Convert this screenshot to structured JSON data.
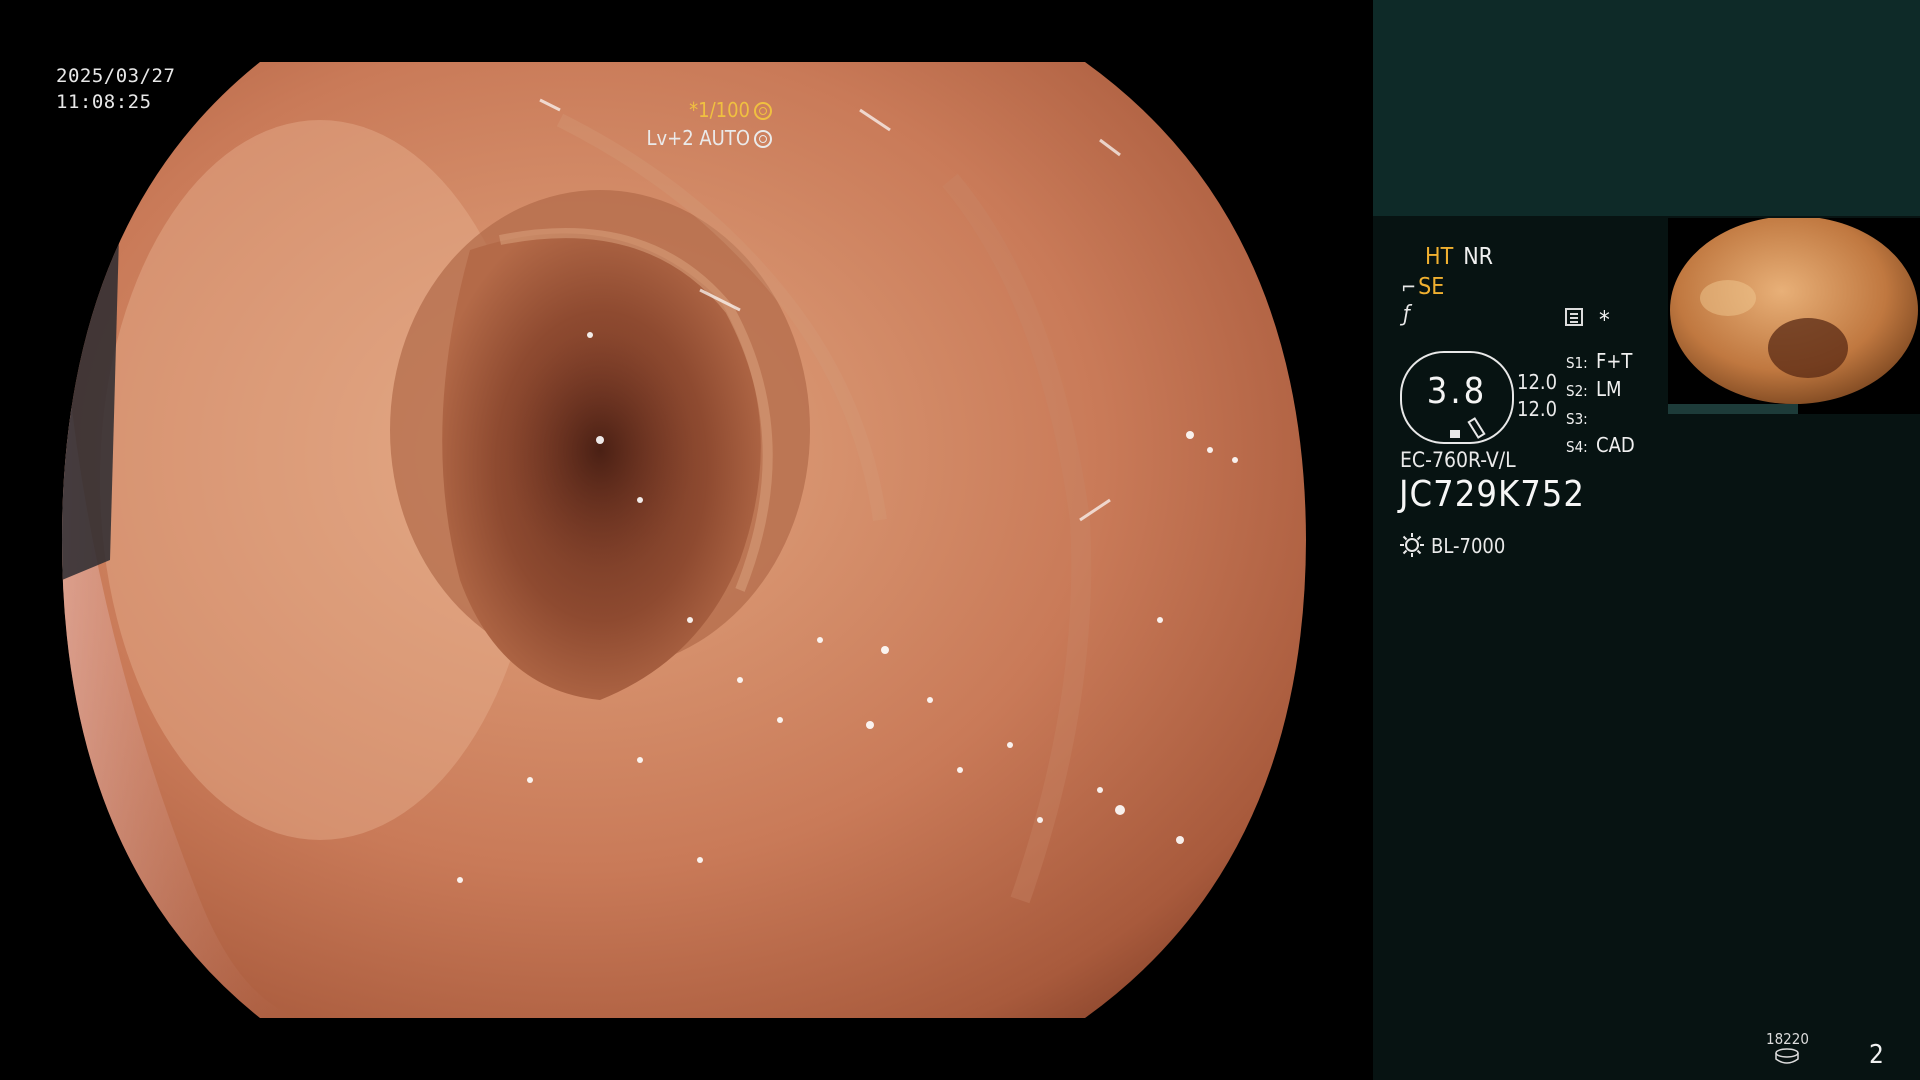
{
  "overlay": {
    "date": "2025/03/27",
    "time": "11:08:25",
    "shutter": "*1/100",
    "level": "Lv+2 AUTO"
  },
  "panel": {
    "ht_label": "HT",
    "nr_label": "NR",
    "se_label": "SE",
    "gauge_value": "3.8",
    "value_a": "12.0",
    "value_b": "12.0",
    "switches": [
      {
        "key": "S1:",
        "value": "F+T"
      },
      {
        "key": "S2:",
        "value": "LM"
      },
      {
        "key": "S3:",
        "value": ""
      },
      {
        "key": "S4:",
        "value": "CAD"
      }
    ],
    "scope_model": "EC-760R-V/L",
    "scope_serial": "JC729K752",
    "light_source": "BL-7000",
    "counter": "18220",
    "page_number": "2"
  },
  "colors": {
    "panel_bg": "#071312",
    "panel_top": "#0e2a28",
    "accent_orange": "#f0b030"
  },
  "icons": [
    "aperture-icon",
    "auto-iris-icon",
    "se-scope-icon",
    "f-icon",
    "menu-icon",
    "star-icon",
    "light-bulb-icon",
    "disk-icon"
  ]
}
